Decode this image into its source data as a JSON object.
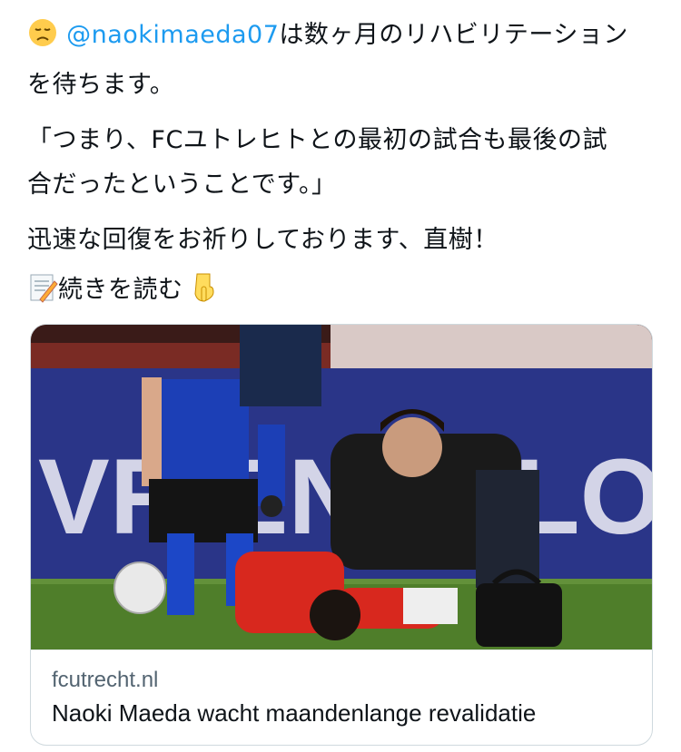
{
  "tweet": {
    "line1_pre": "",
    "mention": "@naokimaeda07",
    "line1_post": "は数ヶ月のリハビリテーション",
    "line2": "を待ちます。",
    "line3": "「つまり、FCユトレヒトとの最初の試合も最後の試",
    "line4": "合だったということです。」",
    "line5": "迅速な回復をお祈りしております、直樹！",
    "line6": "続きを読む"
  },
  "emojis": {
    "sad": "disappointed-face-icon",
    "memo": "memo-icon",
    "point": "pointing-down-icon"
  },
  "card": {
    "domain": "fcutrecht.nl",
    "title": "Naoki Maeda wacht maandenlange revalidatie",
    "banner_text": "VRIENDELOT"
  },
  "colors": {
    "mention": "#1d9bf0",
    "text": "#0f1419",
    "secondary": "#536471",
    "border": "#cfd9de"
  }
}
